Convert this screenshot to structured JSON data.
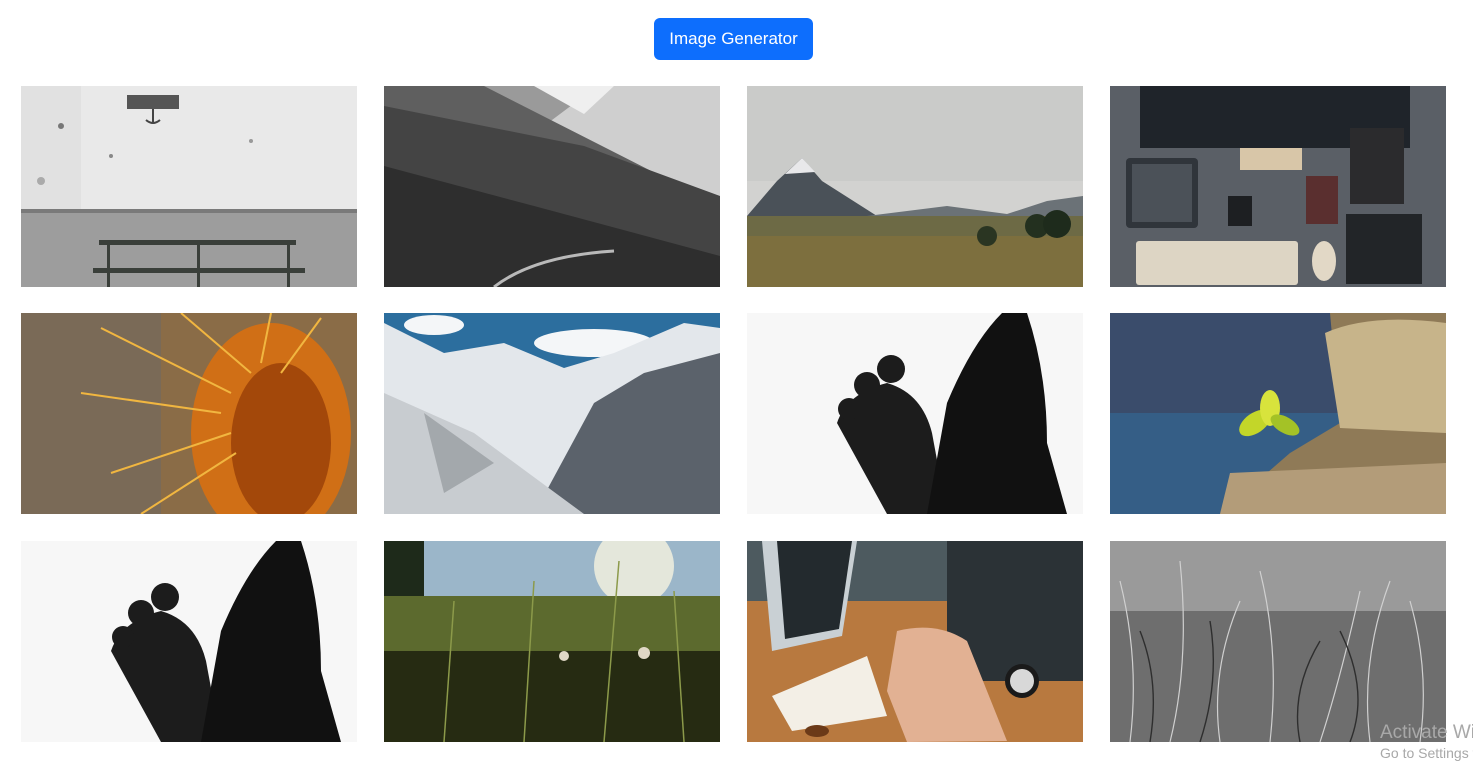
{
  "header": {
    "button_label": "Image Generator"
  },
  "gallery": {
    "images": [
      {
        "subject": "bench-wall"
      },
      {
        "subject": "mountain-bw"
      },
      {
        "subject": "valley-mountain"
      },
      {
        "subject": "desk-devices"
      },
      {
        "subject": "cactus"
      },
      {
        "subject": "snowy-mountains"
      },
      {
        "subject": "feet-silhouette"
      },
      {
        "subject": "sprout-stump"
      },
      {
        "subject": "feet-silhouette"
      },
      {
        "subject": "grass-sunlight"
      },
      {
        "subject": "laptop-notebook"
      },
      {
        "subject": "grass-bw"
      }
    ]
  },
  "os_watermark": {
    "line1": "Activate Windows",
    "line2": "Go to Settings to activate Windows."
  },
  "colors": {
    "primary": "#0d6efd"
  }
}
